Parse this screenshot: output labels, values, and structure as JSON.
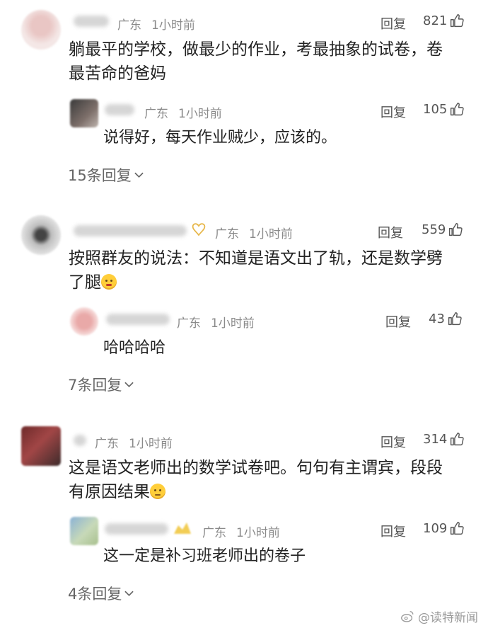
{
  "threads": [
    {
      "author_location": "广东",
      "time": "1小时前",
      "reply_label": "回复",
      "likes": "821",
      "text_line1": "躺最平的学校，做最少的作业，考最抽象的试卷，卷",
      "text_line2": "最苦命的爸妈",
      "reply": {
        "location": "广东",
        "time": "1小时前",
        "reply_label": "回复",
        "likes": "105",
        "text": "说得好，每天作业贼少，应该的。"
      },
      "more_replies": "15条回复"
    },
    {
      "author_location": "广东",
      "time": "1小时前",
      "reply_label": "回复",
      "likes": "559",
      "text_line1": "按照群友的说法：不知道是语文出了轨，还是数学劈",
      "text_line2": "了腿",
      "reply": {
        "location": "广东",
        "time": "1小时前",
        "reply_label": "回复",
        "likes": "43",
        "text": "哈哈哈哈"
      },
      "more_replies": "7条回复"
    },
    {
      "author_location": "广东",
      "time": "1小时前",
      "reply_label": "回复",
      "likes": "314",
      "text_line1": "这是语文老师出的数学试卷吧。句句有主谓宾，段段",
      "text_line2": "有原因结果",
      "reply": {
        "location": "广东",
        "time": "1小时前",
        "reply_label": "回复",
        "likes": "109",
        "text": "这一定是补习班老师出的卷子"
      },
      "more_replies": "4条回复"
    }
  ],
  "watermark": "@读特新闻",
  "icons": {
    "like": "thumbs-up-icon",
    "expand": "chevron-down-icon",
    "emoji_kiss": "kissing-face-emoji",
    "emoji_smile": "smiling-face-emoji",
    "weibo": "weibo-logo-icon"
  }
}
